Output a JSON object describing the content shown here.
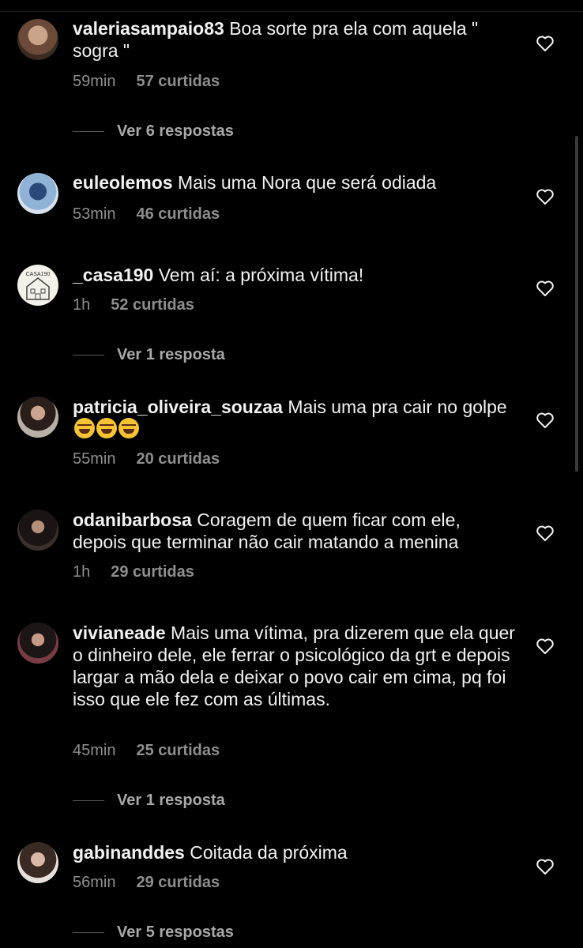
{
  "comments": [
    {
      "user": "valeriasampaio83",
      "text": "Boa sorte pra ela com aquela \" sogra \"",
      "time": "59min",
      "likes": "57 curtidas",
      "replies": "Ver 6 respostas"
    },
    {
      "user": "euleolemos",
      "text": "Mais uma Nora que será odiada",
      "time": "53min",
      "likes": "46 curtidas",
      "replies": ""
    },
    {
      "user": "_casa190",
      "text": "Vem aí: a próxima vítima!",
      "time": "1h",
      "likes": "52 curtidas",
      "replies": "Ver 1 resposta"
    },
    {
      "user": "patricia_oliveira_souzaa",
      "text": "Mais uma pra cair no golpe",
      "time": "55min",
      "likes": "20 curtidas",
      "replies": ""
    },
    {
      "user": "odanibarbosa",
      "text": "Coragem de quem ficar com ele, depois que terminar não cair matando a menina",
      "time": "1h",
      "likes": "29 curtidas",
      "replies": ""
    },
    {
      "user": "vivianeade",
      "text": "Mais uma vítima, pra dizerem que ela quer o dinheiro dele, ele ferrar o psicológico da grt e depois largar a mão dela e deixar o povo cair em cima, pq foi isso que ele fez com as últimas.",
      "time": "45min",
      "likes": "25 curtidas",
      "replies": "Ver 1 resposta"
    },
    {
      "user": "gabinanddes",
      "text": "Coitada da próxima",
      "time": "56min",
      "likes": "29 curtidas",
      "replies": "Ver 5 respostas"
    }
  ],
  "avatar_text": {
    "casa190": "CASA190"
  },
  "colors": {
    "background": "#000000",
    "text": "#f2f2f2",
    "muted": "#8e8e8e"
  },
  "icons": {
    "like": "heart-outline-icon",
    "emoji": "face-with-tears-of-joy"
  }
}
